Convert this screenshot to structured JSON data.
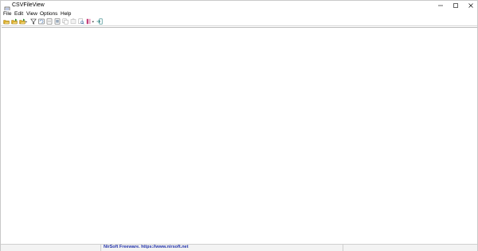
{
  "window": {
    "title": "CSVFileView",
    "controls": {
      "minimize": "minimize",
      "maximize": "maximize",
      "close": "close"
    }
  },
  "menu": {
    "file": "File",
    "edit": "Edit",
    "view": "View",
    "options": "Options",
    "help": "Help"
  },
  "toolbar": {
    "icons": [
      "open-folder-icon",
      "open-folder-add-icon",
      "open-folder-dropdown-icon",
      "filter-icon",
      "refresh-icon",
      "save-icon",
      "properties-icon",
      "copy-icon",
      "copy-disabled-icon",
      "find-icon",
      "column-settings-icon",
      "exit-icon"
    ]
  },
  "status": {
    "panel1": "",
    "link_text": "NirSoft Freeware. https://www.nirsoft.net",
    "panel3": ""
  },
  "colors": {
    "link": "#2233aa",
    "toolbar_green": "#2e8b2e",
    "folder_yellow": "#e6b422"
  }
}
